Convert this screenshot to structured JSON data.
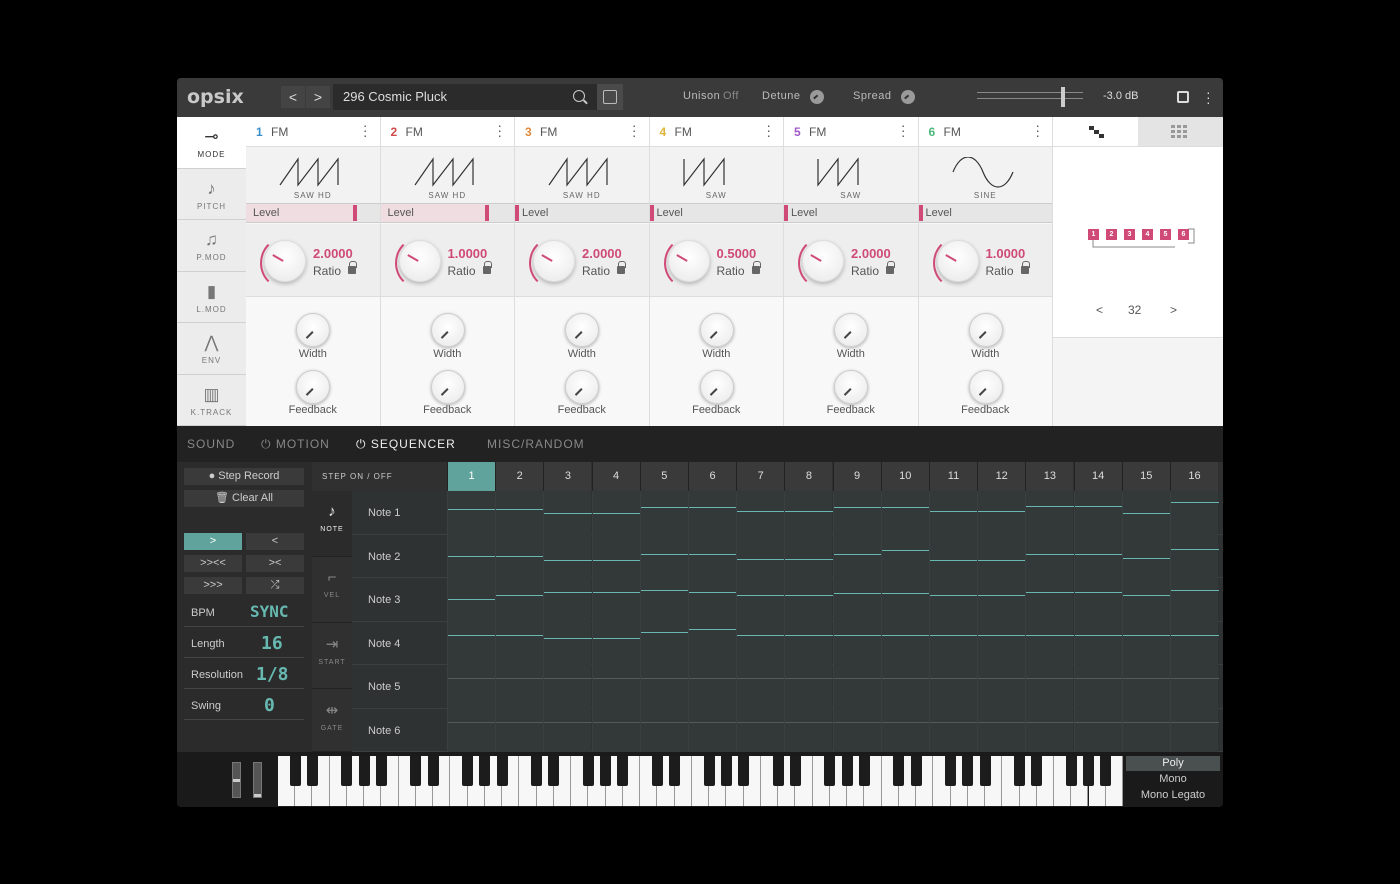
{
  "header": {
    "logo": "opsix",
    "prev": "<",
    "next": ">",
    "program": "296 Cosmic Pluck",
    "unison_label": "Unison",
    "unison_value": "Off",
    "detune_label": "Detune",
    "spread_label": "Spread",
    "volume": "-3.0 dB"
  },
  "sidebar": [
    {
      "label": "MODE",
      "icon": "mode-icon"
    },
    {
      "label": "PITCH",
      "icon": "pitch-icon"
    },
    {
      "label": "P.MOD",
      "icon": "pmod-icon"
    },
    {
      "label": "L.MOD",
      "icon": "lmod-icon"
    },
    {
      "label": "ENV",
      "icon": "env-icon"
    },
    {
      "label": "K.TRACK",
      "icon": "ktrack-icon"
    }
  ],
  "operators": [
    {
      "num": "1",
      "type": "FM",
      "color": "#3a8fc8",
      "wave": "SAW HD",
      "level_label": "Level",
      "ratio": "2.0000",
      "ratio_label": "Ratio",
      "width_label": "Width",
      "feedback_label": "Feedback"
    },
    {
      "num": "2",
      "type": "FM",
      "color": "#d04a4a",
      "wave": "SAW HD",
      "level_label": "Level",
      "ratio": "1.0000",
      "ratio_label": "Ratio",
      "width_label": "Width",
      "feedback_label": "Feedback"
    },
    {
      "num": "3",
      "type": "FM",
      "color": "#e08a3a",
      "wave": "SAW HD",
      "level_label": "Level",
      "ratio": "2.0000",
      "ratio_label": "Ratio",
      "width_label": "Width",
      "feedback_label": "Feedback"
    },
    {
      "num": "4",
      "type": "FM",
      "color": "#e0b43a",
      "wave": "SAW",
      "level_label": "Level",
      "ratio": "0.5000",
      "ratio_label": "Ratio",
      "width_label": "Width",
      "feedback_label": "Feedback"
    },
    {
      "num": "5",
      "type": "FM",
      "color": "#a05ac8",
      "wave": "SAW",
      "level_label": "Level",
      "ratio": "2.0000",
      "ratio_label": "Ratio",
      "width_label": "Width",
      "feedback_label": "Feedback"
    },
    {
      "num": "6",
      "type": "FM",
      "color": "#4ab87a",
      "wave": "SINE",
      "level_label": "Level",
      "ratio": "1.0000",
      "ratio_label": "Ratio",
      "width_label": "Width",
      "feedback_label": "Feedback"
    }
  ],
  "level_fill": [
    0.82,
    0.8,
    0.0,
    0.0,
    0.0,
    0.0
  ],
  "algorithm": {
    "boxes": [
      "1",
      "2",
      "3",
      "4",
      "5",
      "6"
    ],
    "number": "32",
    "prev": "<",
    "next": ">"
  },
  "tabs": [
    "SOUND",
    "MOTION",
    "SEQUENCER",
    "MISC/RANDOM"
  ],
  "seq": {
    "step_record": "Step Record",
    "clear_all": "Clear All",
    "dir_buttons": [
      ">",
      "<",
      ">><<",
      "><",
      ">>>",
      "⤮"
    ],
    "params": [
      {
        "key": "BPM",
        "value": "SYNC"
      },
      {
        "key": "Length",
        "value": "16"
      },
      {
        "key": "Resolution",
        "value": "1/8"
      },
      {
        "key": "Swing",
        "value": "0"
      }
    ],
    "types": [
      {
        "label": "NOTE",
        "icon": "note-icon"
      },
      {
        "label": "VEL",
        "icon": "velocity-icon"
      },
      {
        "label": "START",
        "icon": "start-icon"
      },
      {
        "label": "GATE",
        "icon": "gate-icon"
      }
    ],
    "step_label": "STEP ON / OFF",
    "steps": [
      "1",
      "2",
      "3",
      "4",
      "5",
      "6",
      "7",
      "8",
      "9",
      "10",
      "11",
      "12",
      "13",
      "14",
      "15",
      "16"
    ],
    "rows": [
      "Note 1",
      "Note 2",
      "Note 3",
      "Note 4",
      "Note 5",
      "Note 6"
    ]
  },
  "voice_modes": [
    "Poly",
    "Mono",
    "Mono Legato"
  ],
  "colors": {
    "accent": "#d04a78",
    "teal": "#66b8b0"
  }
}
